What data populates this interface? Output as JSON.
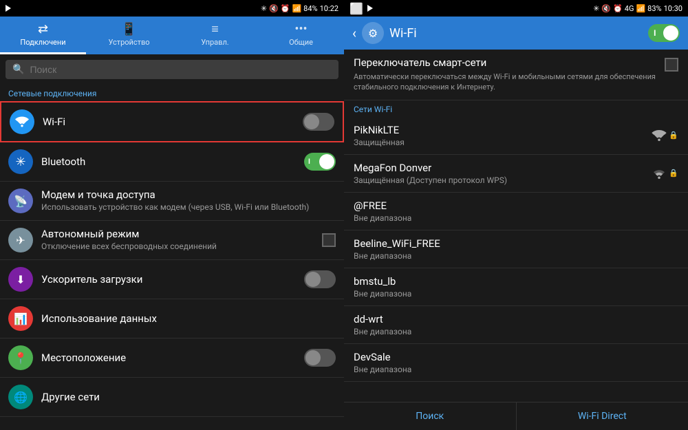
{
  "left": {
    "statusBar": {
      "time": "10:22",
      "battery": "84%"
    },
    "tabs": [
      {
        "label": "Подключени",
        "icon": "⇄",
        "active": true
      },
      {
        "label": "Устройство",
        "icon": "📱",
        "active": false
      },
      {
        "label": "Управл.",
        "icon": "≡",
        "active": false
      },
      {
        "label": "Общие",
        "icon": "•••",
        "active": false
      }
    ],
    "search": {
      "placeholder": "Поиск"
    },
    "sectionHeader": "Сетевые подключения",
    "items": [
      {
        "id": "wifi",
        "title": "Wi-Fi",
        "subtitle": "",
        "icon": "wifi",
        "iconClass": "icon-wifi",
        "hasToggle": true,
        "toggleOn": false,
        "highlighted": true
      },
      {
        "id": "bluetooth",
        "title": "Bluetooth",
        "subtitle": "",
        "icon": "bt",
        "iconClass": "icon-bt",
        "hasToggle": true,
        "toggleOn": true,
        "highlighted": false
      },
      {
        "id": "modem",
        "title": "Модем и точка доступа",
        "subtitle": "Использовать устройство как модем (через USB, Wi-Fi или Bluetooth)",
        "icon": "modem",
        "iconClass": "icon-modem",
        "hasToggle": false,
        "highlighted": false
      },
      {
        "id": "airplane",
        "title": "Автономный режим",
        "subtitle": "Отключение всех беспроводных соединений",
        "icon": "airplane",
        "iconClass": "icon-airplane",
        "hasCheckbox": true,
        "highlighted": false
      },
      {
        "id": "booster",
        "title": "Ускоритель загрузки",
        "subtitle": "",
        "icon": "booster",
        "iconClass": "icon-booster",
        "hasToggle": true,
        "toggleOn": false,
        "highlighted": false
      },
      {
        "id": "data",
        "title": "Использование данных",
        "subtitle": "",
        "icon": "data",
        "iconClass": "icon-data",
        "hasToggle": false,
        "highlighted": false
      },
      {
        "id": "location",
        "title": "Местоположение",
        "subtitle": "",
        "icon": "location",
        "iconClass": "icon-location",
        "hasToggle": true,
        "toggleOn": false,
        "highlighted": false
      },
      {
        "id": "other",
        "title": "Другие сети",
        "subtitle": "",
        "icon": "other",
        "iconClass": "icon-other",
        "hasToggle": false,
        "highlighted": false
      }
    ]
  },
  "right": {
    "statusBar": {
      "time": "10:30",
      "battery": "83%"
    },
    "header": {
      "title": "Wi-Fi"
    },
    "smartSwitch": {
      "title": "Переключатель смарт-сети",
      "desc": "Автоматически переключаться между Wi-Fi и мобильными сетями для обеспечения стабильного подключения к Интернету."
    },
    "networksHeader": "Сети Wi-Fi",
    "networks": [
      {
        "name": "PikNikLTE",
        "status": "Защищённая",
        "hasLock": true,
        "signalStrength": 3
      },
      {
        "name": "MegaFon Donver",
        "status": "Защищённая (Доступен протокол WPS)",
        "hasLock": true,
        "signalStrength": 2
      },
      {
        "name": "@FREE",
        "status": "Вне диапазона",
        "hasLock": false,
        "signalStrength": 0
      },
      {
        "name": "Beeline_WiFi_FREE",
        "status": "Вне диапазона",
        "hasLock": false,
        "signalStrength": 0
      },
      {
        "name": "bmstu_lb",
        "status": "Вне диапазона",
        "hasLock": false,
        "signalStrength": 0
      },
      {
        "name": "dd-wrt",
        "status": "Вне диапазона",
        "hasLock": false,
        "signalStrength": 0
      },
      {
        "name": "DevSale",
        "status": "Вне диапазона",
        "hasLock": false,
        "signalStrength": 0
      }
    ],
    "bottomButtons": [
      {
        "label": "Поиск"
      },
      {
        "label": "Wi-Fi Direct"
      }
    ]
  }
}
